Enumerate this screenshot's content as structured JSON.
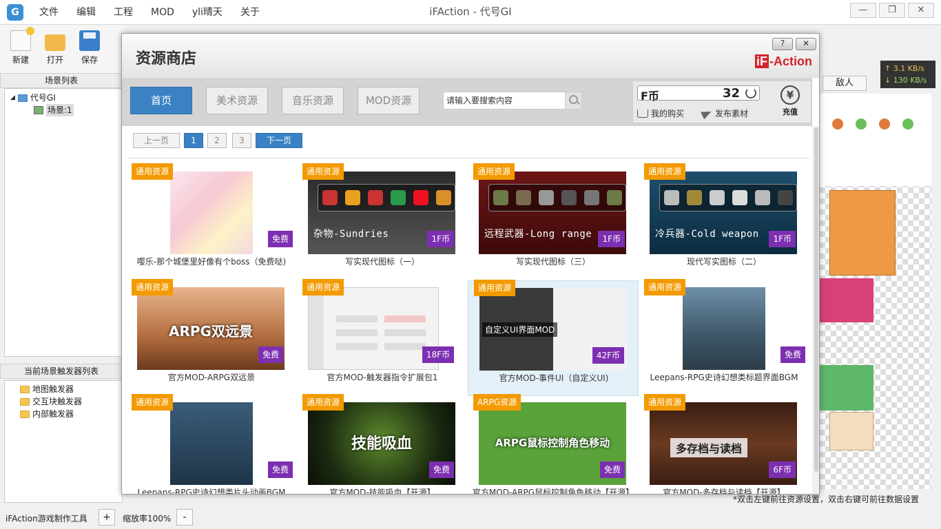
{
  "app": {
    "title": "iFAction - 代号GI",
    "logo": "G",
    "menu": [
      "文件",
      "编辑",
      "工程",
      "MOD",
      "yli晴天",
      "关于"
    ],
    "window_controls": {
      "minimize": "—",
      "restore": "❐",
      "close": "✕"
    }
  },
  "toolbar": {
    "new": "新建",
    "open": "打开",
    "save": "保存"
  },
  "scene_panel": {
    "title": "场景列表",
    "root": "代号GI",
    "child": "场景:1"
  },
  "trigger_panel": {
    "title": "当前场景触发器列表",
    "items": [
      "地图触发器",
      "交互块触发器",
      "内部触发器"
    ]
  },
  "status": {
    "app_name": "iFAction游戏制作工具",
    "zoom_in": "+",
    "zoom": "缩放率100%",
    "zoom_out": "-"
  },
  "right_panel": {
    "enemy_tab": "敌人",
    "speed_up": "↑ 3.1 KB/s",
    "speed_down": "↓ 130 KB/s",
    "hint": "*双击左键前往资源设置，双击右键可前往数据设置"
  },
  "store": {
    "title": "资源商店",
    "help": "?",
    "close": "✕",
    "brand_mark": "iF",
    "brand_text": "-Action",
    "tabs": [
      "首页",
      "美术资源",
      "音乐资源",
      "MOD资源"
    ],
    "search_placeholder": "请输入要搜索内容",
    "currency_label": "F币",
    "currency_value": "32",
    "my_purchases": "我的购买",
    "publish": "发布素材",
    "recharge_icon": "¥",
    "recharge": "充值",
    "pager": {
      "prev": "上一页",
      "pages": [
        "1",
        "2",
        "3"
      ],
      "current": "1",
      "next": "下一页"
    },
    "cards": [
      {
        "tag": "通用资源",
        "price": "免费",
        "title": "嘤乐-那个城堡里好像有个boss（免费哒)",
        "thumb_text": ""
      },
      {
        "tag": "通用资源",
        "price": "1F币",
        "title": "写实现代图标（一）",
        "thumb_text": "杂物-Sundries"
      },
      {
        "tag": "通用资源",
        "price": "1F币",
        "title": "写实现代图标（三）",
        "thumb_text": "远程武器-Long range gun"
      },
      {
        "tag": "通用资源",
        "price": "1F币",
        "title": "现代写实图标（二）",
        "thumb_text": "冷兵器-Cold weapon"
      },
      {
        "tag": "通用资源",
        "price": "免费",
        "title": "官方MOD-ARPG双远景",
        "thumb_text": "ARPG双远景"
      },
      {
        "tag": "通用资源",
        "price": "18F币",
        "title": "官方MOD-触发器指令扩展包1",
        "thumb_text": ""
      },
      {
        "tag": "通用资源",
        "price": "42F币",
        "title": "官方MOD-事件UI（自定义UI)",
        "thumb_text": "自定义UI界面MOD"
      },
      {
        "tag": "通用资源",
        "price": "免费",
        "title": "Leepans-RPG史诗幻想类标题界面BGM",
        "thumb_text": ""
      },
      {
        "tag": "通用资源",
        "price": "免费",
        "title": "Leepans-RPG史诗幻想类片头动画BGM",
        "thumb_text": ""
      },
      {
        "tag": "通用资源",
        "price": "免费",
        "title": "官方MOD-技能吸血【开源】",
        "thumb_text": "技能吸血"
      },
      {
        "tag": "ARPG资源",
        "price": "免费",
        "title": "官方MOD-ARPG鼠标控制角色移动【开源】",
        "thumb_text": "ARPG鼠标控制角色移动"
      },
      {
        "tag": "通用资源",
        "price": "6F币",
        "title": "官方MOD-多存档与读档【开源】",
        "thumb_text": "多存档与读档"
      }
    ]
  }
}
